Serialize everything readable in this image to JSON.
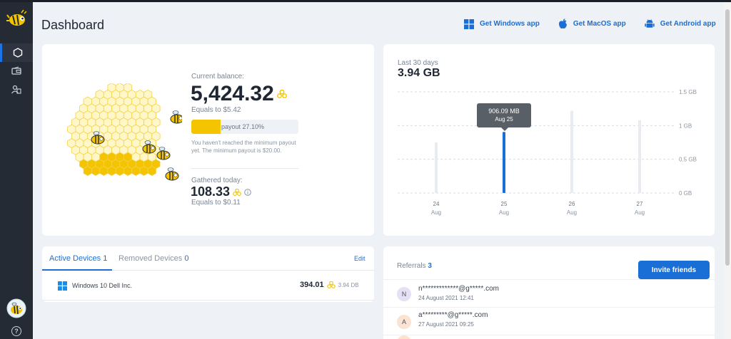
{
  "page": {
    "title": "Dashboard"
  },
  "apps": [
    {
      "label": "Get Windows app",
      "icon": "windows-icon"
    },
    {
      "label": "Get MacOS app",
      "icon": "apple-icon"
    },
    {
      "label": "Get Android app",
      "icon": "android-icon"
    }
  ],
  "sidebar": {
    "items": [
      {
        "name": "dashboard",
        "icon": "hexagon-icon",
        "active": true
      },
      {
        "name": "payouts",
        "icon": "wallet-icon",
        "active": false
      },
      {
        "name": "referrals",
        "icon": "people-icon",
        "active": false
      }
    ],
    "help_label": "?"
  },
  "balance": {
    "current_label": "Current balance:",
    "current_value": "5,424.32",
    "current_equals": "Equals to $5.42",
    "payout_text": "payout 27.10%",
    "payout_fraction": 0.271,
    "payout_note": "You haven't reached the minimum payout yet. The minimum payout is $20.00.",
    "today_label": "Gathered today:",
    "today_value": "108.33",
    "today_equals": "Equals to $0.11"
  },
  "traffic": {
    "period_label": "Last 30 days",
    "total": "3.94 GB",
    "tooltip_value": "906.09 MB",
    "tooltip_date": "Aug 25"
  },
  "chart_data": {
    "type": "bar",
    "categories": [
      "24 Aug",
      "25 Aug",
      "26 Aug",
      "27 Aug"
    ],
    "values": [
      0.75,
      0.906,
      1.22,
      1.08
    ],
    "highlight_index": 1,
    "ylim": [
      0,
      1.5
    ],
    "yticks": [
      "0 GB",
      "0.5 GB",
      "1 GB",
      "1.5 GB"
    ],
    "xticks": [
      {
        "day": "24",
        "month": "Aug"
      },
      {
        "day": "25",
        "month": "Aug"
      },
      {
        "day": "26",
        "month": "Aug"
      },
      {
        "day": "27",
        "month": "Aug"
      }
    ],
    "grid": true
  },
  "devices": {
    "tab_active_label": "Active Devices",
    "tab_active_count": "1",
    "tab_removed_label": "Removed Devices",
    "tab_removed_count": "0",
    "edit_label": "Edit",
    "rows": [
      {
        "name": "Windows 10 Dell Inc.",
        "value": "394.01",
        "traffic": "3.94 DB"
      }
    ]
  },
  "referrals": {
    "label": "Referrals",
    "count": "3",
    "invite_label": "Invite friends",
    "rows": [
      {
        "initial": "N",
        "email": "n*************@g*****.com",
        "date": "24 August 2021 12:41",
        "color": "#e6e0f5"
      },
      {
        "initial": "A",
        "email": "a*********@g*****.com",
        "date": "27 August 2021 09:25",
        "color": "#fbe3d3"
      }
    ]
  },
  "colors": {
    "accent": "#1a6fd6",
    "honey": "#f5c400",
    "sidebar": "#252b35",
    "bar_inactive": "#e8ecf1"
  }
}
